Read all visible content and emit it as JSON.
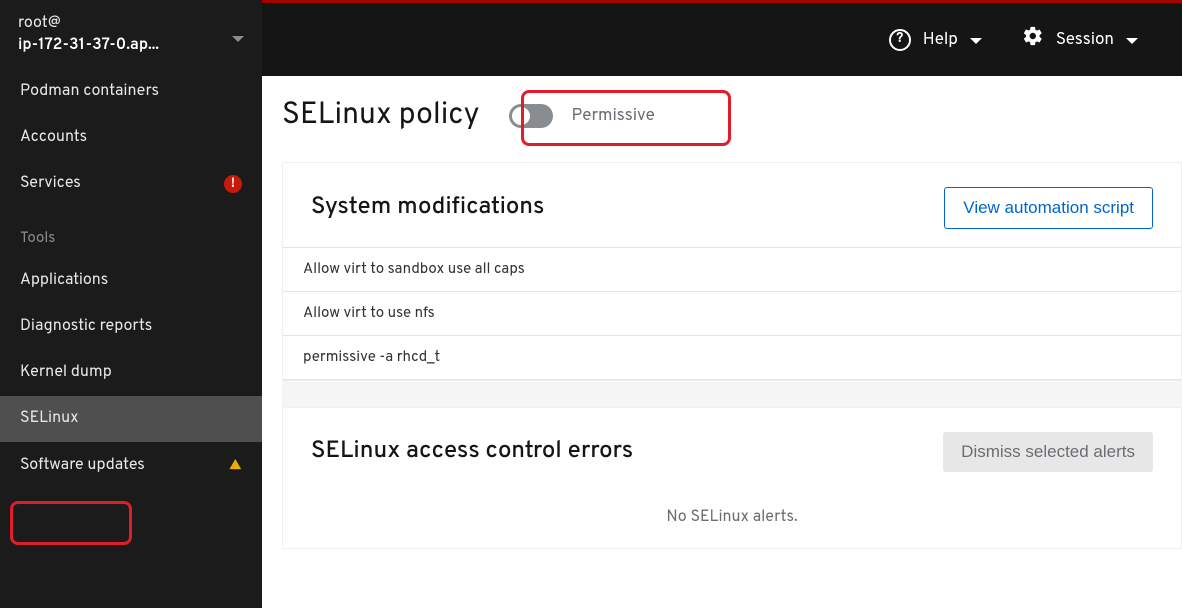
{
  "host": {
    "user": "root@",
    "name": "ip-172-31-37-0.ap..."
  },
  "nav": {
    "items": [
      {
        "label": "Podman containers",
        "badge": null
      },
      {
        "label": "Accounts",
        "badge": null
      },
      {
        "label": "Services",
        "badge": "error"
      }
    ],
    "tools_label": "Tools",
    "tools": [
      {
        "label": "Applications",
        "badge": null
      },
      {
        "label": "Diagnostic reports",
        "badge": null
      },
      {
        "label": "Kernel dump",
        "badge": null
      },
      {
        "label": "SELinux",
        "badge": null,
        "selected": true
      },
      {
        "label": "Software updates",
        "badge": "warn"
      }
    ]
  },
  "topbar": {
    "help": "Help",
    "session": "Session"
  },
  "page": {
    "title": "SELinux policy",
    "toggle_label": "Permissive"
  },
  "modifications": {
    "title": "System modifications",
    "view_script": "View automation script",
    "items": [
      "Allow virt to sandbox use all caps",
      "Allow virt to use nfs",
      "permissive -a rhcd_t"
    ]
  },
  "errors": {
    "title": "SELinux access control errors",
    "dismiss": "Dismiss selected alerts",
    "empty": "No SELinux alerts."
  }
}
